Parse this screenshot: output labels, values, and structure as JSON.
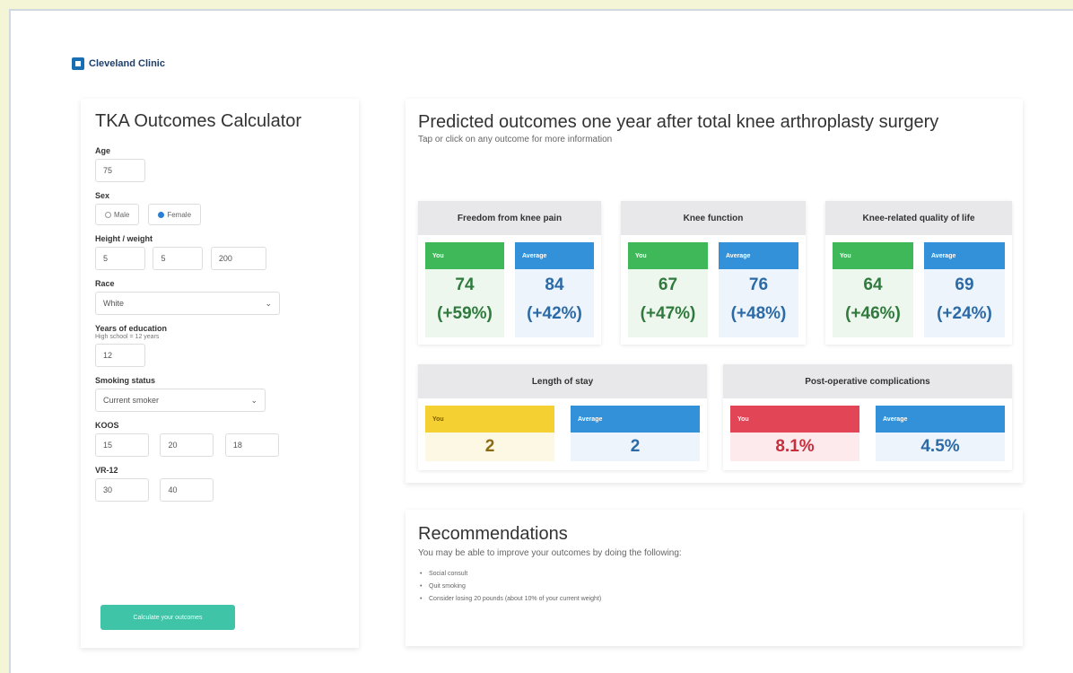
{
  "brand": {
    "name": "Cleveland Clinic"
  },
  "calculator": {
    "title": "TKA Outcomes Calculator",
    "age": {
      "label": "Age",
      "value": "75"
    },
    "sex": {
      "label": "Sex",
      "options": [
        "Male",
        "Female"
      ],
      "selected": "Female"
    },
    "height_weight": {
      "label": "Height / weight",
      "feet": "5",
      "inches": "5",
      "pounds": "200"
    },
    "race": {
      "label": "Race",
      "value": "White"
    },
    "education": {
      "label": "Years of education",
      "hint": "High school = 12 years",
      "value": "12"
    },
    "smoking": {
      "label": "Smoking status",
      "value": "Current smoker"
    },
    "koos": {
      "label": "KOOS",
      "values": [
        "15",
        "20",
        "18"
      ]
    },
    "vr12": {
      "label": "VR-12",
      "values": [
        "30",
        "40"
      ]
    },
    "button_label": "Calculate your outcomes"
  },
  "outcomes": {
    "title": "Predicted outcomes one year after total knee arthroplasty surgery",
    "subtitle": "Tap or click on any outcome for more information",
    "you_label": "You",
    "average_label": "Average",
    "pain": {
      "title": "Freedom from knee pain",
      "you": "74",
      "you_change": "(+59%)",
      "avg": "84",
      "avg_change": "(+42%)"
    },
    "function": {
      "title": "Knee function",
      "you": "67",
      "you_change": "(+47%)",
      "avg": "76",
      "avg_change": "(+48%)"
    },
    "qol": {
      "title": "Knee-related quality of life",
      "you": "64",
      "you_change": "(+46%)",
      "avg": "69",
      "avg_change": "(+24%)"
    },
    "stay": {
      "title": "Length of stay",
      "you": "2",
      "avg": "2"
    },
    "complications": {
      "title": "Post-operative complications",
      "you": "8.1%",
      "avg": "4.5%"
    }
  },
  "recommendations": {
    "title": "Recommendations",
    "subtitle": "You may be able to improve your outcomes by doing the following:",
    "items": [
      "Social consult",
      "Quit smoking",
      "Consider losing 20 pounds (about 10% of your current weight)"
    ]
  }
}
